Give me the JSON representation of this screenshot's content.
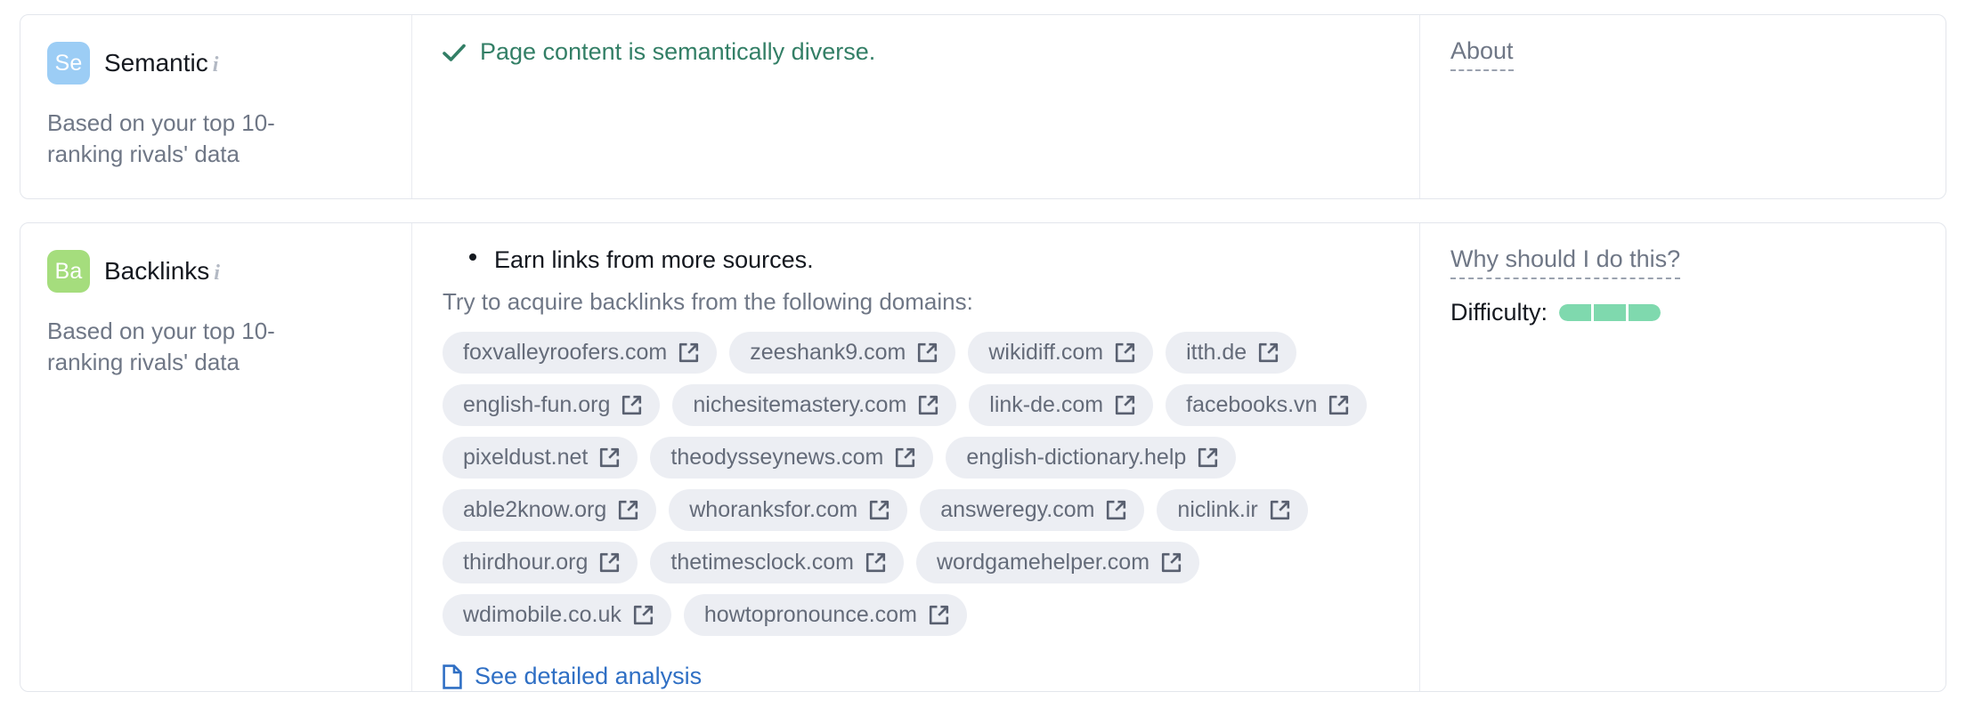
{
  "theme": {
    "semantic_badge_color": "#9ccdf5",
    "backlinks_badge_color": "#a5dd7d",
    "success_text_color": "#337f66",
    "link_color": "#2f6fc4",
    "chip_bg_color": "#eceef3",
    "difficulty_fill_color": "#7fd9ae",
    "card_border_color": "#e3e6ec"
  },
  "cards": [
    {
      "id": "semantic",
      "badge_text": "Se",
      "title": "Semantic",
      "info_icon": "info-icon",
      "subtitle": "Based on your top 10-ranking rivals' data",
      "status": {
        "icon": "check-icon",
        "text": "Page content is semantically diverse."
      },
      "aside": {
        "link_label": "About"
      }
    },
    {
      "id": "backlinks",
      "badge_text": "Ba",
      "title": "Backlinks",
      "info_icon": "info-icon",
      "subtitle": "Based on your top 10-ranking rivals' data",
      "recommendation": "Earn links from more sources.",
      "sub_note": "Try to acquire backlinks from the following domains:",
      "domains": [
        "foxvalleyroofers.com",
        "zeeshank9.com",
        "wikidiff.com",
        "itth.de",
        "english-fun.org",
        "nichesitemastery.com",
        "link-de.com",
        "facebooks.vn",
        "pixeldust.net",
        "theodysseynews.com",
        "english-dictionary.help",
        "able2know.org",
        "whoranksfor.com",
        "answeregy.com",
        "niclink.ir",
        "thirdhour.org",
        "thetimesclock.com",
        "wordgamehelper.com",
        "wdimobile.co.uk",
        "howtopronounce.com"
      ],
      "detail_link": {
        "icon": "document-icon",
        "label": "See detailed analysis"
      },
      "aside": {
        "link_label": "Why should I do this?",
        "difficulty_label": "Difficulty:",
        "difficulty_filled": 3,
        "difficulty_total": 3
      }
    }
  ]
}
